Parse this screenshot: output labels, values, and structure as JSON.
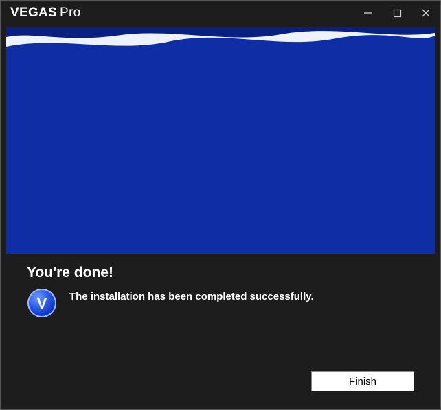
{
  "titlebar": {
    "brand_bold": "VEGAS",
    "brand_light": "Pro"
  },
  "content": {
    "heading": "You're done!",
    "message": "The installation has been completed successfully."
  },
  "footer": {
    "finish_label": "Finish"
  }
}
